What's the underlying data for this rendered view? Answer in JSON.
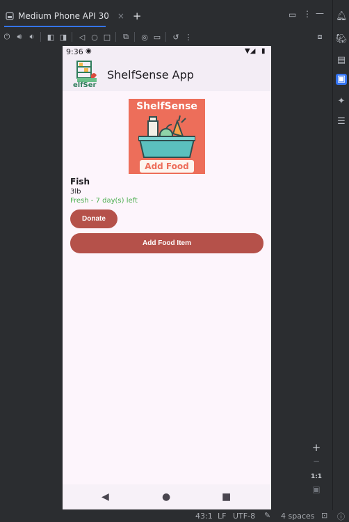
{
  "ide": {
    "tab_title": "Medium Phone API 30",
    "tab_close": "×",
    "tab_add": "+",
    "window_menu": "⋮",
    "window_minimize": "—",
    "status": {
      "position": "43:1",
      "line_ending": "LF",
      "encoding": "UTF-8",
      "indent": "4 spaces"
    },
    "zoom": {
      "plus": "+",
      "minus": "−",
      "ratio": "1:1"
    }
  },
  "phone": {
    "status_time": "9:36",
    "app_title": "ShelfSense App",
    "logo_partial_text": "elfSer",
    "banner": {
      "title": "ShelfSense",
      "button_label": "Add Food"
    },
    "food_item": {
      "name": "Fish",
      "quantity": "3lb",
      "freshness": "Fresh - 7 day(s) left"
    },
    "donate_label": "Donate",
    "add_food_item_label": "Add Food Item"
  },
  "colors": {
    "accent": "#b5514a",
    "banner_bg": "#ed6e5a",
    "fresh_text": "#4caf50",
    "ide_bg": "#2b2d30",
    "ide_accent": "#3574f0"
  }
}
